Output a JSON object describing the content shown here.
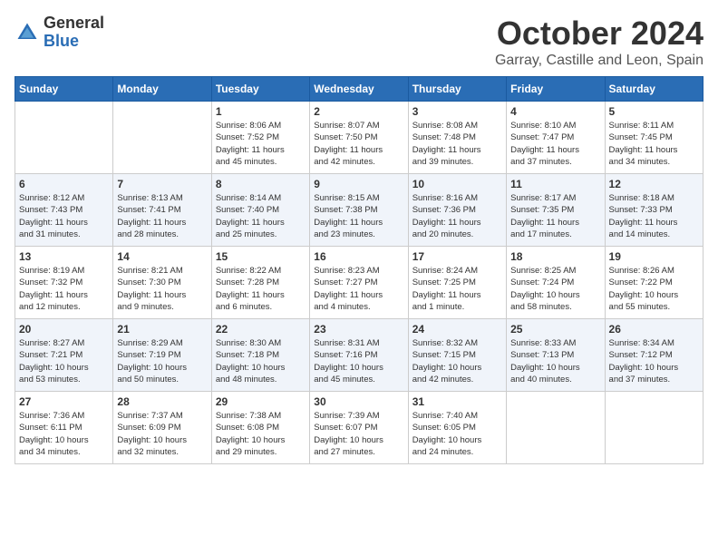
{
  "logo": {
    "general": "General",
    "blue": "Blue"
  },
  "title": {
    "month": "October 2024",
    "location": "Garray, Castille and Leon, Spain"
  },
  "weekdays": [
    "Sunday",
    "Monday",
    "Tuesday",
    "Wednesday",
    "Thursday",
    "Friday",
    "Saturday"
  ],
  "weeks": [
    [
      {
        "day": "",
        "info": ""
      },
      {
        "day": "",
        "info": ""
      },
      {
        "day": "1",
        "info": "Sunrise: 8:06 AM\nSunset: 7:52 PM\nDaylight: 11 hours\nand 45 minutes."
      },
      {
        "day": "2",
        "info": "Sunrise: 8:07 AM\nSunset: 7:50 PM\nDaylight: 11 hours\nand 42 minutes."
      },
      {
        "day": "3",
        "info": "Sunrise: 8:08 AM\nSunset: 7:48 PM\nDaylight: 11 hours\nand 39 minutes."
      },
      {
        "day": "4",
        "info": "Sunrise: 8:10 AM\nSunset: 7:47 PM\nDaylight: 11 hours\nand 37 minutes."
      },
      {
        "day": "5",
        "info": "Sunrise: 8:11 AM\nSunset: 7:45 PM\nDaylight: 11 hours\nand 34 minutes."
      }
    ],
    [
      {
        "day": "6",
        "info": "Sunrise: 8:12 AM\nSunset: 7:43 PM\nDaylight: 11 hours\nand 31 minutes."
      },
      {
        "day": "7",
        "info": "Sunrise: 8:13 AM\nSunset: 7:41 PM\nDaylight: 11 hours\nand 28 minutes."
      },
      {
        "day": "8",
        "info": "Sunrise: 8:14 AM\nSunset: 7:40 PM\nDaylight: 11 hours\nand 25 minutes."
      },
      {
        "day": "9",
        "info": "Sunrise: 8:15 AM\nSunset: 7:38 PM\nDaylight: 11 hours\nand 23 minutes."
      },
      {
        "day": "10",
        "info": "Sunrise: 8:16 AM\nSunset: 7:36 PM\nDaylight: 11 hours\nand 20 minutes."
      },
      {
        "day": "11",
        "info": "Sunrise: 8:17 AM\nSunset: 7:35 PM\nDaylight: 11 hours\nand 17 minutes."
      },
      {
        "day": "12",
        "info": "Sunrise: 8:18 AM\nSunset: 7:33 PM\nDaylight: 11 hours\nand 14 minutes."
      }
    ],
    [
      {
        "day": "13",
        "info": "Sunrise: 8:19 AM\nSunset: 7:32 PM\nDaylight: 11 hours\nand 12 minutes."
      },
      {
        "day": "14",
        "info": "Sunrise: 8:21 AM\nSunset: 7:30 PM\nDaylight: 11 hours\nand 9 minutes."
      },
      {
        "day": "15",
        "info": "Sunrise: 8:22 AM\nSunset: 7:28 PM\nDaylight: 11 hours\nand 6 minutes."
      },
      {
        "day": "16",
        "info": "Sunrise: 8:23 AM\nSunset: 7:27 PM\nDaylight: 11 hours\nand 4 minutes."
      },
      {
        "day": "17",
        "info": "Sunrise: 8:24 AM\nSunset: 7:25 PM\nDaylight: 11 hours\nand 1 minute."
      },
      {
        "day": "18",
        "info": "Sunrise: 8:25 AM\nSunset: 7:24 PM\nDaylight: 10 hours\nand 58 minutes."
      },
      {
        "day": "19",
        "info": "Sunrise: 8:26 AM\nSunset: 7:22 PM\nDaylight: 10 hours\nand 55 minutes."
      }
    ],
    [
      {
        "day": "20",
        "info": "Sunrise: 8:27 AM\nSunset: 7:21 PM\nDaylight: 10 hours\nand 53 minutes."
      },
      {
        "day": "21",
        "info": "Sunrise: 8:29 AM\nSunset: 7:19 PM\nDaylight: 10 hours\nand 50 minutes."
      },
      {
        "day": "22",
        "info": "Sunrise: 8:30 AM\nSunset: 7:18 PM\nDaylight: 10 hours\nand 48 minutes."
      },
      {
        "day": "23",
        "info": "Sunrise: 8:31 AM\nSunset: 7:16 PM\nDaylight: 10 hours\nand 45 minutes."
      },
      {
        "day": "24",
        "info": "Sunrise: 8:32 AM\nSunset: 7:15 PM\nDaylight: 10 hours\nand 42 minutes."
      },
      {
        "day": "25",
        "info": "Sunrise: 8:33 AM\nSunset: 7:13 PM\nDaylight: 10 hours\nand 40 minutes."
      },
      {
        "day": "26",
        "info": "Sunrise: 8:34 AM\nSunset: 7:12 PM\nDaylight: 10 hours\nand 37 minutes."
      }
    ],
    [
      {
        "day": "27",
        "info": "Sunrise: 7:36 AM\nSunset: 6:11 PM\nDaylight: 10 hours\nand 34 minutes."
      },
      {
        "day": "28",
        "info": "Sunrise: 7:37 AM\nSunset: 6:09 PM\nDaylight: 10 hours\nand 32 minutes."
      },
      {
        "day": "29",
        "info": "Sunrise: 7:38 AM\nSunset: 6:08 PM\nDaylight: 10 hours\nand 29 minutes."
      },
      {
        "day": "30",
        "info": "Sunrise: 7:39 AM\nSunset: 6:07 PM\nDaylight: 10 hours\nand 27 minutes."
      },
      {
        "day": "31",
        "info": "Sunrise: 7:40 AM\nSunset: 6:05 PM\nDaylight: 10 hours\nand 24 minutes."
      },
      {
        "day": "",
        "info": ""
      },
      {
        "day": "",
        "info": ""
      }
    ]
  ]
}
